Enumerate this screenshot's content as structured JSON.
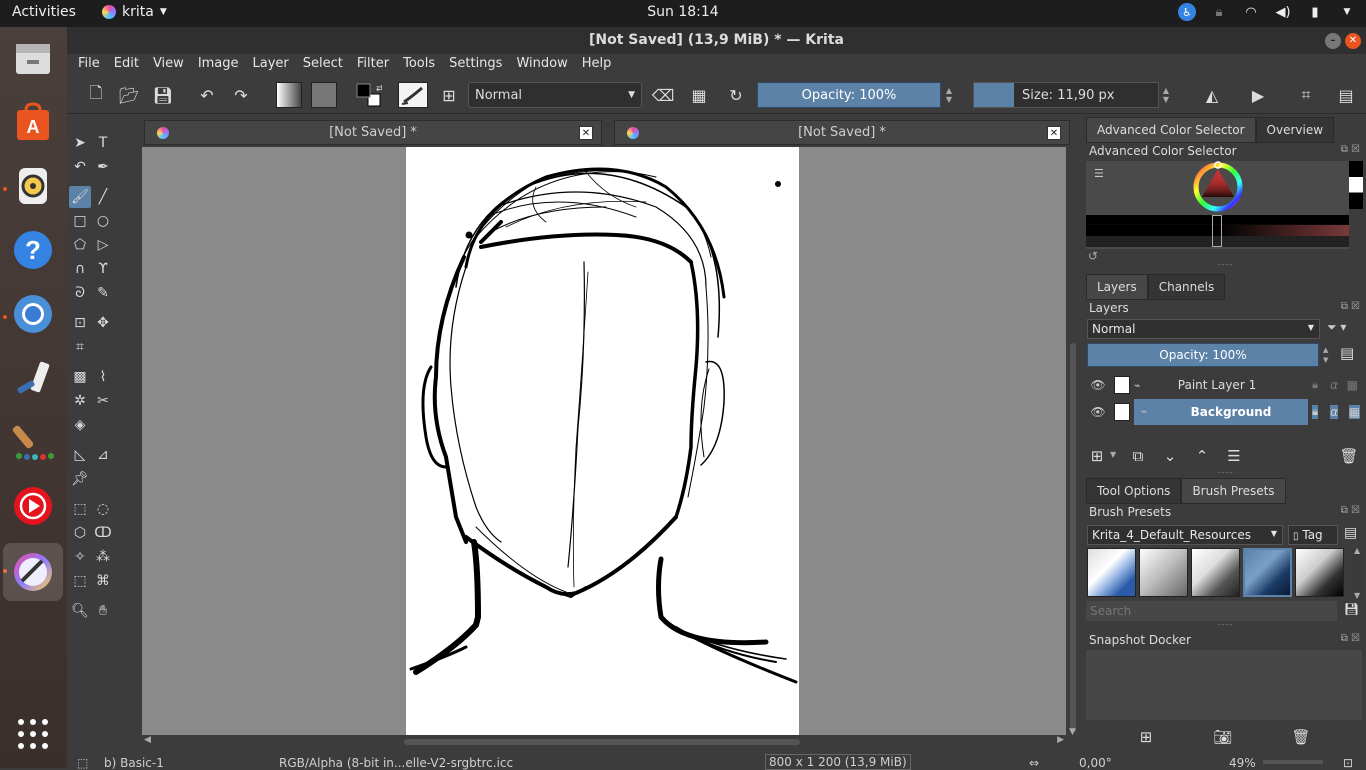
{
  "topbar": {
    "activities": "Activities",
    "app_name": "krita",
    "clock": "Sun 18:14"
  },
  "dock": {
    "items": [
      "files-icon",
      "software-icon",
      "rhythmbox-icon",
      "help-icon",
      "chromium-icon",
      "paint-tube-icon",
      "brush-palette-icon",
      "youtube-icon",
      "krita-icon",
      "show-apps-icon"
    ]
  },
  "window": {
    "title": "[Not Saved]  (13,9 MiB)  * — Krita"
  },
  "menu": [
    "File",
    "Edit",
    "View",
    "Image",
    "Layer",
    "Select",
    "Filter",
    "Tools",
    "Settings",
    "Window",
    "Help"
  ],
  "toolbar": {
    "blend_mode": "Normal",
    "opacity": "Opacity: 100%",
    "size": "Size: 11,90 px"
  },
  "tabs": [
    {
      "title": "[Not Saved]  *"
    },
    {
      "title": "[Not Saved]  *"
    }
  ],
  "dockers": {
    "color_tabs": [
      "Advanced Color Selector",
      "Overview"
    ],
    "color_title": "Advanced Color Selector",
    "layer_tabs": [
      "Layers",
      "Channels"
    ],
    "layers_title": "Layers",
    "layer_blend": "Normal",
    "layer_opacity": "Opacity:  100%",
    "layers": [
      {
        "name": "Paint Layer 1",
        "selected": false
      },
      {
        "name": "Background",
        "selected": true
      }
    ],
    "tool_tabs": [
      "Tool Options",
      "Brush Presets"
    ],
    "brush_title": "Brush Presets",
    "brush_resource": "Krita_4_Default_Resources",
    "brush_tag": "Tag",
    "brush_search_placeholder": "Search",
    "snapshot_title": "Snapshot Docker"
  },
  "status": {
    "brush": "b) Basic-1",
    "colorspace": "RGB/Alpha (8-bit in...elle-V2-srgbtrc.icc",
    "dimensions": "800 x 1 200 (13,9 MiB)",
    "rotation": "0,00°",
    "zoom": "49%"
  }
}
